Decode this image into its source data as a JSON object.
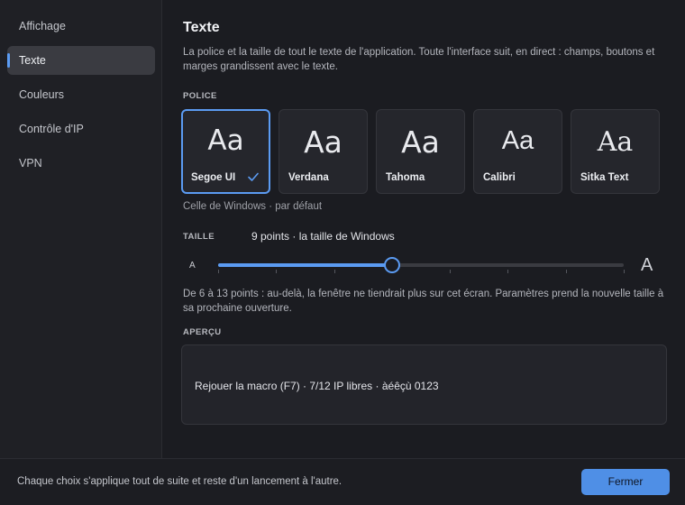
{
  "sidebar": {
    "items": [
      {
        "label": "Affichage"
      },
      {
        "label": "Texte"
      },
      {
        "label": "Couleurs"
      },
      {
        "label": "Contrôle d'IP"
      },
      {
        "label": "VPN"
      }
    ],
    "active_index": 1
  },
  "main": {
    "title": "Texte",
    "description": "La police et la taille de tout le texte de l'application. Toute l'interface suit, en direct : champs, boutons et marges grandissent avec le texte."
  },
  "font_section": {
    "label": "POLICE",
    "sample": "Aa",
    "fonts": [
      {
        "name": "Segoe UI",
        "selected": true
      },
      {
        "name": "Verdana",
        "selected": false
      },
      {
        "name": "Tahoma",
        "selected": false
      },
      {
        "name": "Calibri",
        "selected": false
      },
      {
        "name": "Sitka Text",
        "selected": false
      }
    ],
    "selected_description": "Celle de Windows · par défaut"
  },
  "size_section": {
    "label": "TAILLE",
    "value_text": "9 points · la taille de Windows",
    "small_marker": "A",
    "large_marker": "A",
    "min": 6,
    "max": 13,
    "value": 9,
    "note": "De 6 à 13 points : au-delà, la fenêtre ne tiendrait plus sur cet écran. Paramètres prend la nouvelle taille à sa prochaine ouverture."
  },
  "preview_section": {
    "label": "APERÇU",
    "text": "Rejouer la macro (F7) · 7/12 IP libres · àéêçù 0123"
  },
  "footer": {
    "note": "Chaque choix s'applique tout de suite et reste d'un lancement à l'autre.",
    "close_label": "Fermer"
  },
  "colors": {
    "accent": "#5b9bf2",
    "button": "#4f8fe6"
  }
}
